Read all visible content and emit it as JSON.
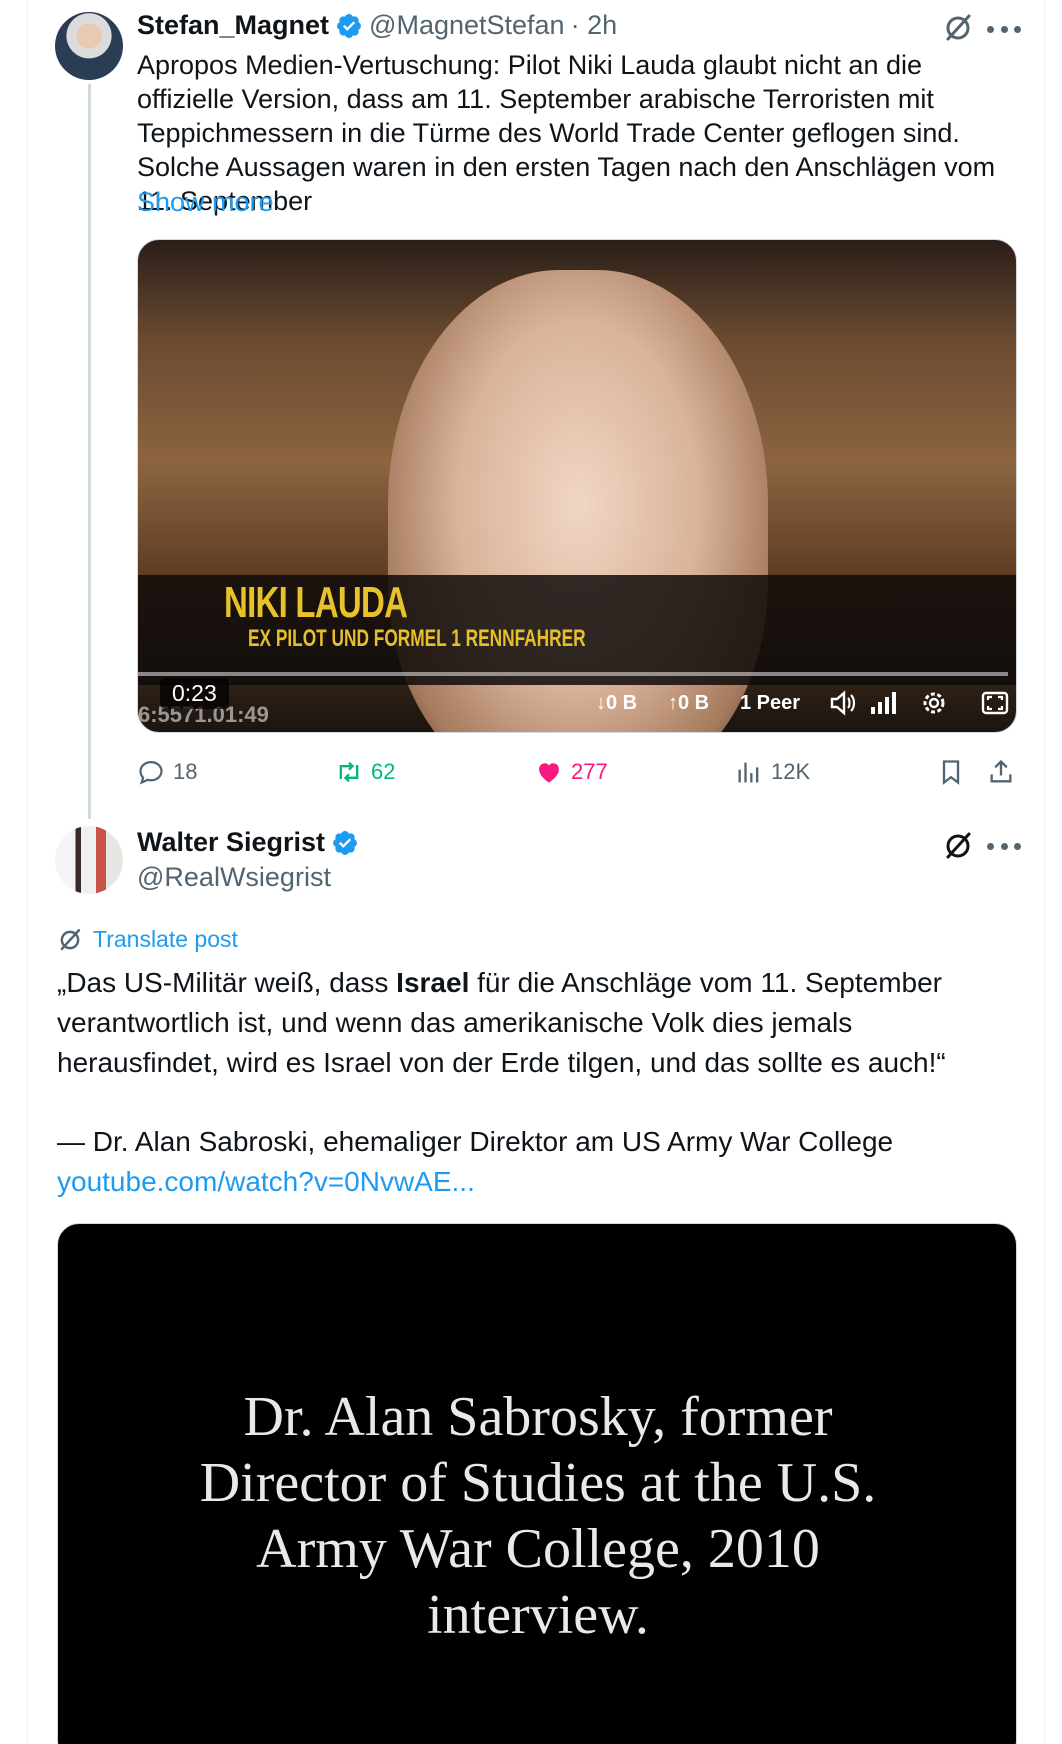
{
  "tweet1": {
    "display_name": "Stefan_Magnet",
    "handle": "@MagnetStefan",
    "time": "· 2h",
    "text": "Apropos Medien-Vertuschung: Pilot Niki Lauda glaubt nicht an die offizielle Version, dass am 11. September arabische Terroristen mit Teppichmessern in die Türme des World Trade Center geflogen sind. Solche Aussagen waren in den ersten Tagen nach den Anschlägen vom 11. September",
    "show_more": "Show more",
    "video": {
      "caption_name": "NIKI LAUDA",
      "caption_sub": "EX PILOT UND FORMEL 1 RENNFAHRER",
      "duration": "0:23",
      "timecode": "6:5571.01:49",
      "down_rate": "0 B",
      "up_rate": "0 B",
      "peers": "1 Peer"
    },
    "replies": "18",
    "reposts": "62",
    "likes": "277",
    "views": "12K"
  },
  "tweet2": {
    "display_name": "Walter Siegrist",
    "handle": "@RealWsiegrist",
    "translate": "Translate post",
    "quote_part1": "„Das US-Militär weiß, dass ",
    "quote_bold": "Israel",
    "quote_part2": " für die Anschläge vom 11. September verantwortlich ist, und wenn das amerikanische Volk dies jemals herausfindet, wird es Israel von der Erde tilgen, und das sollte es auch!“",
    "attribution": "— Dr. Alan Sabroski, ehemaliger Direktor am US Army War College",
    "link": "youtube.com/watch?v=0NvwAE...",
    "video_text_1": "Dr. Alan Sabrosky, former",
    "video_text_2": "Director of Studies at the U.S.",
    "video_text_3": "Army War College, 2010",
    "video_text_4": "interview."
  },
  "colors": {
    "accent": "#1d9bf0",
    "repost": "#00ba7c",
    "like": "#f91880",
    "secondary_text": "#536471"
  },
  "icons": [
    "verified-badge-icon",
    "grok-icon",
    "more-icon",
    "reply-icon",
    "repost-icon",
    "like-icon",
    "views-icon",
    "bookmark-icon",
    "share-icon",
    "translate-icon",
    "volume-icon",
    "signal-icon",
    "settings-icon",
    "fullscreen-icon"
  ]
}
